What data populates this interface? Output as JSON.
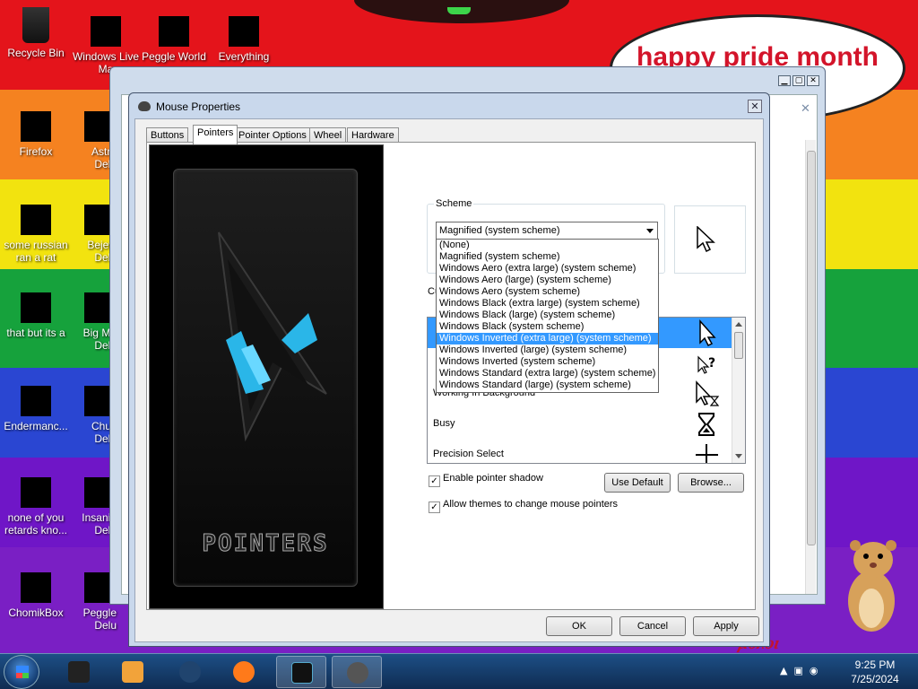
{
  "desktop": {
    "icons": [
      {
        "label": "Recycle Bin",
        "name": "recycle-bin-icon"
      },
      {
        "label": "Windows Live Ma",
        "name": "windows-live-icon"
      },
      {
        "label": "Peggle World",
        "name": "peggle-world-icon"
      },
      {
        "label": "Everything",
        "name": "everything-icon"
      },
      {
        "label": "Firefox",
        "name": "firefox-icon"
      },
      {
        "label": "Astro Delu",
        "name": "astro-deluxe-icon"
      },
      {
        "label": "some russian ran a rat",
        "name": "some-russian-icon"
      },
      {
        "label": "Bejew Delu",
        "name": "bejeweled-icon"
      },
      {
        "label": "that but its a",
        "name": "that-but-icon"
      },
      {
        "label": "Big Mo Delu",
        "name": "big-money-icon"
      },
      {
        "label": "Endermanc...",
        "name": "enderman-icon"
      },
      {
        "label": "Chuz Delu",
        "name": "chuzzle-icon"
      },
      {
        "label": "none of you retards kno...",
        "name": "none-of-you-icon"
      },
      {
        "label": "Insaniq Delu",
        "name": "insaniquarium-icon"
      },
      {
        "label": "ChomikBox",
        "name": "chomikbox-icon"
      },
      {
        "label": "Peggle Delu",
        "name": "peggle-deluxe-icon"
      }
    ],
    "cloud_text": "happy pride month",
    "bottom_tag": "μολοι"
  },
  "dialog": {
    "title": "Mouse Properties",
    "close_label": "✕",
    "tabs": [
      "Buttons",
      "Pointers",
      "Pointer Options",
      "Wheel",
      "Hardware"
    ],
    "active_tab": "Pointers",
    "banner_word": "POINTERS",
    "scheme": {
      "label": "Scheme",
      "selected": "Magnified (system scheme)",
      "options": [
        "(None)",
        "Magnified (system scheme)",
        "Windows Aero (extra large) (system scheme)",
        "Windows Aero (large) (system scheme)",
        "Windows Aero (system scheme)",
        "Windows Black (extra large) (system scheme)",
        "Windows Black (large) (system scheme)",
        "Windows Black (system scheme)",
        "Windows Inverted (extra large) (system scheme)",
        "Windows Inverted (large) (system scheme)",
        "Windows Inverted (system scheme)",
        "Windows Standard (extra large) (system scheme)",
        "Windows Standard (large) (system scheme)"
      ],
      "highlighted_index": 8
    },
    "customize_label": "Cu",
    "cursor_rows": [
      {
        "label": "",
        "icon": "arrow-cursor-icon"
      },
      {
        "label": "",
        "icon": "help-select-cursor-icon"
      },
      {
        "label": "Working In Background",
        "icon": "working-background-cursor-icon"
      },
      {
        "label": "Busy",
        "icon": "hourglass-cursor-icon"
      },
      {
        "label": "Precision Select",
        "icon": "crosshair-cursor-icon"
      }
    ],
    "enable_shadow_label": "Enable pointer shadow",
    "allow_themes_label": "Allow themes to change mouse pointers",
    "use_default_label": "Use Default",
    "browse_label": "Browse...",
    "ok_label": "OK",
    "cancel_label": "Cancel",
    "apply_label": "Apply"
  },
  "taskbar": {
    "time": "9:25 PM",
    "date": "7/25/2024"
  }
}
